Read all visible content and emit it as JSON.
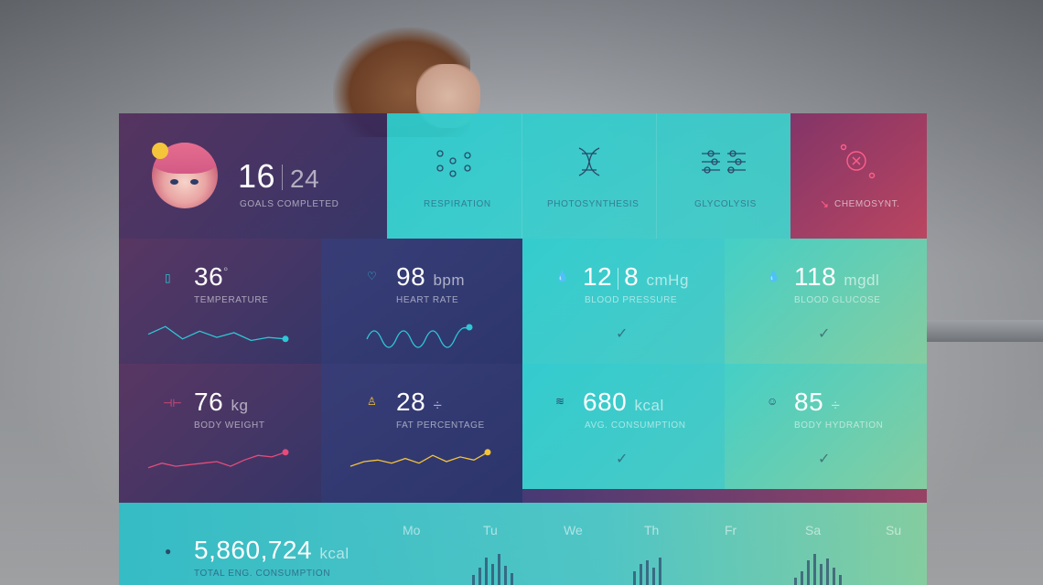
{
  "profile": {
    "goals_done": "16",
    "goals_total": "24",
    "goals_label": "GOALS COMPLETED"
  },
  "processes": [
    {
      "label": "RESPIRATION",
      "icon": "dots-icon"
    },
    {
      "label": "PHOTOSYNTHESIS",
      "icon": "dna-icon"
    },
    {
      "label": "GLYCOLYSIS",
      "icon": "sliders-icon"
    },
    {
      "label": "CHEMOSYNT.",
      "icon": "close-circle-icon"
    }
  ],
  "metrics": {
    "temperature": {
      "value": "36",
      "unit": "°",
      "label": "TEMPERATURE",
      "color": "#2fc7d6",
      "series": [
        0.45,
        0.7,
        0.3,
        0.55,
        0.35,
        0.5,
        0.25,
        0.35,
        0.3
      ]
    },
    "heart_rate": {
      "value": "98",
      "unit": "bpm",
      "label": "HEART RATE",
      "color": "#2fc7d6"
    },
    "blood_pressure": {
      "value": "12",
      "value2": "8",
      "unit": "cmHg",
      "label": "BLOOD PRESSURE"
    },
    "blood_glucose": {
      "value": "118",
      "unit": "mgdl",
      "label": "BLOOD GLUCOSE"
    },
    "body_weight": {
      "value": "76",
      "unit": "kg",
      "label": "BODY WEIGHT",
      "color": "#e54c7b",
      "series": [
        0.3,
        0.45,
        0.35,
        0.4,
        0.45,
        0.5,
        0.35,
        0.55,
        0.7,
        0.65,
        0.8
      ]
    },
    "fat_percentage": {
      "value": "28",
      "unit": "÷",
      "label": "FAT PERCENTAGE",
      "color": "#f4c43b",
      "series": [
        0.35,
        0.5,
        0.55,
        0.45,
        0.6,
        0.45,
        0.7,
        0.5,
        0.65,
        0.55,
        0.8
      ]
    },
    "avg_consumption": {
      "value": "680",
      "unit": "kcal",
      "label": "AVG. CONSUMPTION"
    },
    "body_hydration": {
      "value": "85",
      "unit": "÷",
      "label": "BODY HYDRATION"
    }
  },
  "bottom": {
    "value": "5,860,724",
    "unit": "kcal",
    "label": "TOTAL ENG. CONSUMPTION",
    "days": [
      "Mo",
      "Tu",
      "We",
      "Th",
      "Fr",
      "Sa",
      "Su"
    ],
    "bars": [
      [
        0,
        0,
        0
      ],
      [
        0.3,
        0.5,
        0.8,
        0.6,
        0.9,
        0.55,
        0.35
      ],
      [],
      [
        0.4,
        0.6,
        0.7,
        0.5,
        0.8
      ],
      [],
      [
        0.2,
        0.4,
        0.7,
        0.9,
        0.6,
        0.75,
        0.5,
        0.3
      ],
      []
    ]
  }
}
